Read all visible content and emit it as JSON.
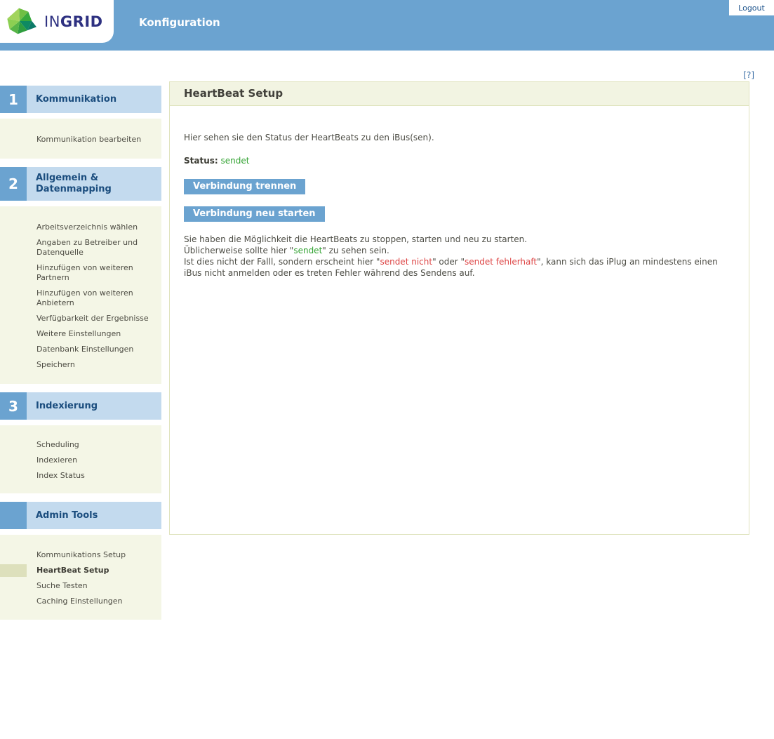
{
  "header": {
    "logo_thin": "IN",
    "logo_bold": "GRID",
    "title": "Konfiguration",
    "logout_label": "Logout"
  },
  "help_link_label": "[?]",
  "sidebar": {
    "sections": [
      {
        "number": "1",
        "title": "Kommunikation",
        "items": [
          {
            "label": "Kommunikation bearbeiten"
          }
        ]
      },
      {
        "number": "2",
        "title": "Allgemein & Datenmapping",
        "items": [
          {
            "label": "Arbeitsverzeichnis wählen"
          },
          {
            "label": "Angaben zu Betreiber und Datenquelle"
          },
          {
            "label": "Hinzufügen von weiteren Partnern"
          },
          {
            "label": "Hinzufügen von weiteren Anbietern"
          },
          {
            "label": "Verfügbarkeit der Ergebnisse"
          },
          {
            "label": "Weitere Einstellungen"
          },
          {
            "label": "Datenbank Einstellungen"
          },
          {
            "label": "Speichern"
          }
        ]
      },
      {
        "number": "3",
        "title": "Indexierung",
        "items": [
          {
            "label": "Scheduling"
          },
          {
            "label": "Indexieren"
          },
          {
            "label": "Index Status"
          }
        ]
      },
      {
        "number": "",
        "title": "Admin Tools",
        "items": [
          {
            "label": "Kommunikations Setup"
          },
          {
            "label": "HeartBeat Setup",
            "active": true
          },
          {
            "label": "Suche Testen"
          },
          {
            "label": "Caching Einstellungen"
          }
        ]
      }
    ]
  },
  "main": {
    "panel_title": "HeartBeat Setup",
    "intro": "Hier sehen sie den Status der HeartBeats zu den iBus(sen).",
    "status_label": "Status:",
    "status_value": "sendet",
    "buttons": [
      {
        "label": "Verbindung trennen"
      },
      {
        "label": "Verbindung neu starten"
      }
    ],
    "description": {
      "l1": "Sie haben die Möglichkeit die HeartBeats zu stoppen, starten und neu zu starten.",
      "l2a": "Üblicherweise sollte hier \"",
      "l2b": "sendet",
      "l2c": "\" zu sehen sein.",
      "l3a": "Ist dies nicht der Falll, sondern erscheint hier \"",
      "l3b": "sendet nicht",
      "l3c": "\" oder \"",
      "l3d": "sendet fehlerhaft",
      "l3e": "\", kann sich das iPlug an mindestens einen iBus nicht anmelden oder es treten Fehler während des Sendens auf."
    }
  },
  "colors": {
    "header_blue": "#6ba3d0",
    "section_light_blue": "#c3daee",
    "section_text_blue": "#1b4d7e",
    "cream": "#f4f6e6",
    "panel_border": "#dfe3bd",
    "status_ok_green": "#33a333",
    "status_err_red": "#dd4444",
    "logo_navy": "#2e3181",
    "active_item_marker": "#dde0bc"
  }
}
